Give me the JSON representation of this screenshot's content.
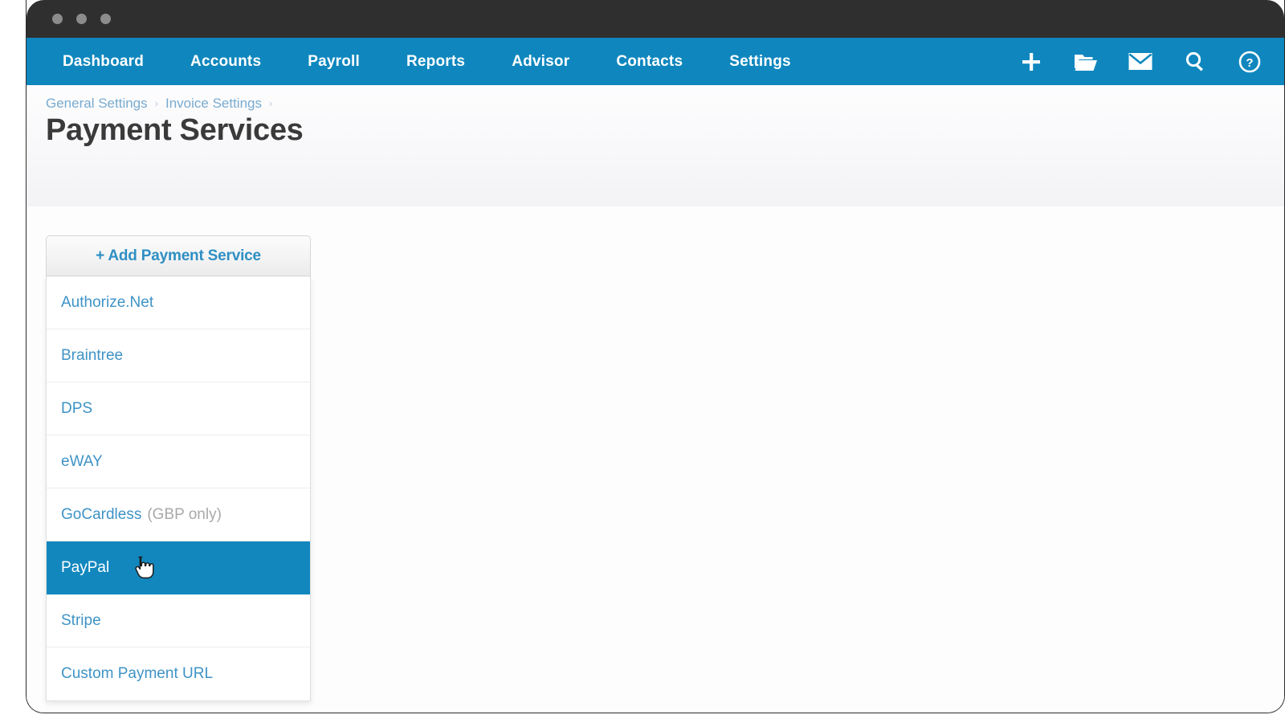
{
  "window": {
    "traffic_lights": [
      "close",
      "minimize",
      "zoom"
    ]
  },
  "nav": {
    "links": [
      {
        "label": "Dashboard",
        "name": "nav-link-dashboard"
      },
      {
        "label": "Accounts",
        "name": "nav-link-accounts"
      },
      {
        "label": "Payroll",
        "name": "nav-link-payroll"
      },
      {
        "label": "Reports",
        "name": "nav-link-reports"
      },
      {
        "label": "Advisor",
        "name": "nav-link-advisor"
      },
      {
        "label": "Contacts",
        "name": "nav-link-contacts"
      },
      {
        "label": "Settings",
        "name": "nav-link-settings"
      }
    ],
    "icons": [
      {
        "name": "plus-icon",
        "glyph": "plus"
      },
      {
        "name": "folder-open-icon",
        "glyph": "folder"
      },
      {
        "name": "mail-icon",
        "glyph": "envelope"
      },
      {
        "name": "search-icon",
        "glyph": "magnifier"
      },
      {
        "name": "help-icon",
        "glyph": "question-circle"
      }
    ],
    "background_color": "#0f87be"
  },
  "header": {
    "breadcrumb": [
      {
        "label": "General Settings"
      },
      {
        "label": "Invoice Settings"
      }
    ],
    "breadcrumb_separator": "›",
    "title": "Payment Services"
  },
  "widget": {
    "add_button_label": "+ Add Payment Service",
    "options": [
      {
        "label": "Authorize.Net",
        "suffix": "",
        "selected": false
      },
      {
        "label": "Braintree",
        "suffix": "",
        "selected": false
      },
      {
        "label": "DPS",
        "suffix": "",
        "selected": false
      },
      {
        "label": "eWAY",
        "suffix": "",
        "selected": false
      },
      {
        "label": "GoCardless",
        "suffix": "(GBP only)",
        "selected": false
      },
      {
        "label": "PayPal",
        "suffix": "",
        "selected": true
      },
      {
        "label": "Stripe",
        "suffix": "",
        "selected": false
      },
      {
        "label": "Custom Payment URL",
        "suffix": "",
        "selected": false
      }
    ],
    "selected_option": "PayPal",
    "highlight_color": "#1287be",
    "link_color": "#3e93c6"
  }
}
